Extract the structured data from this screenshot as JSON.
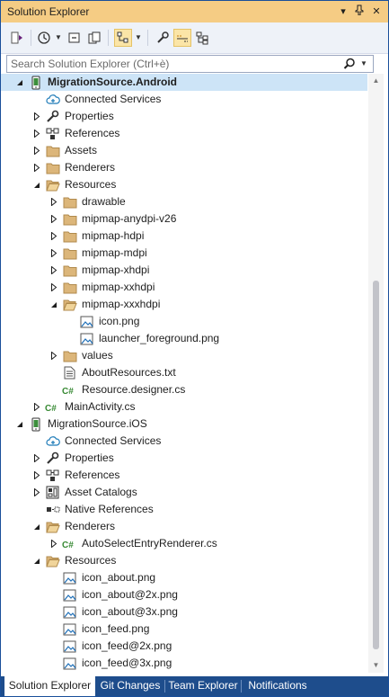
{
  "window": {
    "title": "Solution Explorer",
    "controls": {
      "dropdown": "▾",
      "pin": "📌",
      "close": "✕"
    }
  },
  "toolbar": {
    "buttons": [
      "switch-views-icon",
      "history-icon",
      "collapse-all-icon",
      "show-all-files-icon",
      "sync-with-document-icon",
      "properties-icon",
      "preview-selected-icon",
      "class-view-icon"
    ]
  },
  "search": {
    "placeholder": "Search Solution Explorer (Ctrl+è)"
  },
  "tree": [
    {
      "label": "MigrationSource.Android",
      "icon": "android-project-icon",
      "expander": "expanded",
      "bold": true,
      "selected": true
    },
    {
      "label": "Connected Services",
      "icon": "connected-services-icon",
      "expander": "none"
    },
    {
      "label": "Properties",
      "icon": "wrench-icon",
      "expander": "collapsed"
    },
    {
      "label": "References",
      "icon": "references-icon",
      "expander": "collapsed"
    },
    {
      "label": "Assets",
      "icon": "folder-icon",
      "expander": "collapsed"
    },
    {
      "label": "Renderers",
      "icon": "folder-icon",
      "expander": "collapsed"
    },
    {
      "label": "Resources",
      "icon": "folder-open-icon",
      "expander": "expanded"
    },
    {
      "label": "drawable",
      "icon": "folder-icon",
      "expander": "collapsed"
    },
    {
      "label": "mipmap-anydpi-v26",
      "icon": "folder-icon",
      "expander": "collapsed"
    },
    {
      "label": "mipmap-hdpi",
      "icon": "folder-icon",
      "expander": "collapsed"
    },
    {
      "label": "mipmap-mdpi",
      "icon": "folder-icon",
      "expander": "collapsed"
    },
    {
      "label": "mipmap-xhdpi",
      "icon": "folder-icon",
      "expander": "collapsed"
    },
    {
      "label": "mipmap-xxhdpi",
      "icon": "folder-icon",
      "expander": "collapsed"
    },
    {
      "label": "mipmap-xxxhdpi",
      "icon": "folder-open-icon",
      "expander": "expanded"
    },
    {
      "label": "icon.png",
      "icon": "image-file-icon",
      "expander": "none"
    },
    {
      "label": "launcher_foreground.png",
      "icon": "image-file-icon",
      "expander": "none"
    },
    {
      "label": "values",
      "icon": "folder-icon",
      "expander": "collapsed"
    },
    {
      "label": "AboutResources.txt",
      "icon": "text-file-icon",
      "expander": "none"
    },
    {
      "label": "Resource.designer.cs",
      "icon": "csharp-file-icon",
      "expander": "none"
    },
    {
      "label": "MainActivity.cs",
      "icon": "csharp-file-icon",
      "expander": "collapsed"
    },
    {
      "label": "MigrationSource.iOS",
      "icon": "ios-project-icon",
      "expander": "expanded"
    },
    {
      "label": "Connected Services",
      "icon": "connected-services-icon",
      "expander": "none"
    },
    {
      "label": "Properties",
      "icon": "wrench-icon",
      "expander": "collapsed"
    },
    {
      "label": "References",
      "icon": "references-icon",
      "expander": "collapsed"
    },
    {
      "label": "Asset Catalogs",
      "icon": "asset-catalog-icon",
      "expander": "collapsed"
    },
    {
      "label": "Native References",
      "icon": "native-references-icon",
      "expander": "none"
    },
    {
      "label": "Renderers",
      "icon": "folder-open-icon",
      "expander": "expanded"
    },
    {
      "label": "AutoSelectEntryRenderer.cs",
      "icon": "csharp-file-icon",
      "expander": "collapsed"
    },
    {
      "label": "Resources",
      "icon": "folder-open-icon",
      "expander": "expanded"
    },
    {
      "label": "icon_about.png",
      "icon": "image-file-icon",
      "expander": "none"
    },
    {
      "label": "icon_about@2x.png",
      "icon": "image-file-icon",
      "expander": "none"
    },
    {
      "label": "icon_about@3x.png",
      "icon": "image-file-icon",
      "expander": "none"
    },
    {
      "label": "icon_feed.png",
      "icon": "image-file-icon",
      "expander": "none"
    },
    {
      "label": "icon_feed@2x.png",
      "icon": "image-file-icon",
      "expander": "none"
    },
    {
      "label": "icon_feed@3x.png",
      "icon": "image-file-icon",
      "expander": "none"
    }
  ],
  "tabs": [
    "Solution Explorer",
    "Git Changes",
    "Team Explorer",
    "Notifications"
  ],
  "colors": {
    "title_bar": "#f5cc84",
    "tab_strip": "#1e4d8c",
    "selection": "#cde4f7",
    "folder": "#dcb67a",
    "csharp": "#388a34"
  }
}
